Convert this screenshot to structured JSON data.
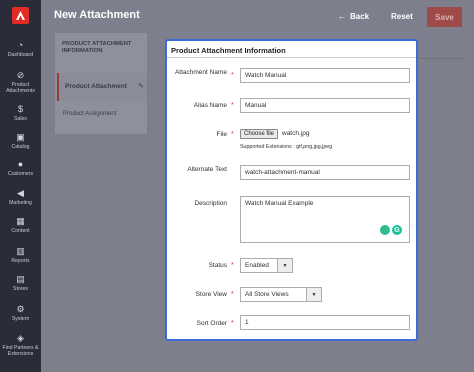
{
  "app": {
    "title": "New Attachment"
  },
  "header": {
    "back_label": "Back",
    "back_icon": "arrow-left-icon",
    "reset_label": "Reset",
    "save_label": "Save"
  },
  "sidebar": {
    "items": [
      {
        "label": "Dashboard",
        "icon": "speedometer-icon"
      },
      {
        "label": "Product Attachments",
        "icon": "paperclip-icon"
      },
      {
        "label": "Sales",
        "icon": "dollar-icon"
      },
      {
        "label": "Catalog",
        "icon": "box-icon"
      },
      {
        "label": "Customers",
        "icon": "person-icon"
      },
      {
        "label": "Marketing",
        "icon": "megaphone-icon"
      },
      {
        "label": "Content",
        "icon": "layout-icon"
      },
      {
        "label": "Reports",
        "icon": "bar-chart-icon"
      },
      {
        "label": "Stores",
        "icon": "store-icon"
      },
      {
        "label": "System",
        "icon": "gear-icon"
      },
      {
        "label": "Find Partners & Extensions",
        "icon": "puzzle-icon"
      }
    ]
  },
  "tabs": {
    "title": "PRODUCT ATTACHMENT INFORMATION",
    "items": [
      {
        "label": "Product Attachment",
        "active": true
      },
      {
        "label": "Product Assignment",
        "active": false
      }
    ]
  },
  "panel": {
    "title": "Product Attachment Information",
    "fields": {
      "attachment_name": {
        "label": "Attachment Name",
        "value": "Watch Manual"
      },
      "alias_name": {
        "label": "Alias Name",
        "value": "Manual"
      },
      "file": {
        "label": "File",
        "button": "Choose file",
        "filename": "watch.jpg",
        "note": "Supported Extensions : gif,png,jpg,jpeg"
      },
      "alternate_text": {
        "label": "Alternate Text",
        "value": "watch-attachment-manual"
      },
      "description": {
        "label": "Description",
        "value": "Watch Manual Example"
      },
      "status": {
        "label": "Status",
        "value": "Enabled"
      },
      "store_view": {
        "label": "Store View",
        "value": "All Store Views"
      },
      "sort_order": {
        "label": "Sort Order",
        "value": "1"
      }
    },
    "required_marker": "*"
  },
  "colors": {
    "accent": "#e02b27",
    "focus": "#3b6bd6",
    "sidebar": "#2b2c3a"
  }
}
